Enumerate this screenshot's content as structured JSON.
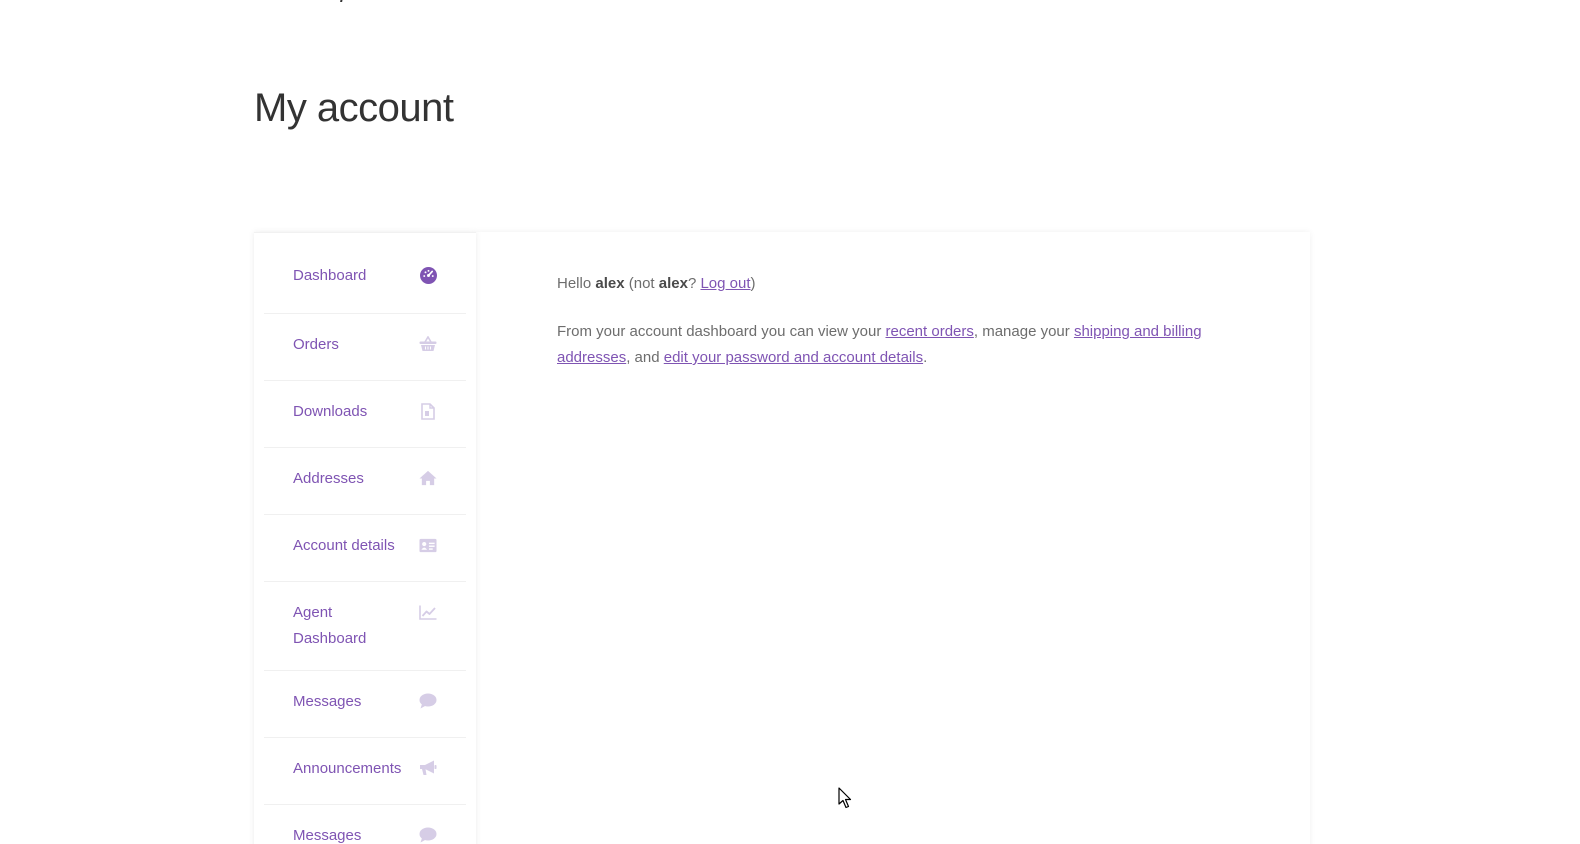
{
  "page": {
    "title": "My account"
  },
  "nav": {
    "items": [
      {
        "label": "Dashboard",
        "icon": "dashboard-icon",
        "active": true
      },
      {
        "label": "Orders",
        "icon": "basket-icon"
      },
      {
        "label": "Downloads",
        "icon": "file-icon"
      },
      {
        "label": "Addresses",
        "icon": "home-icon"
      },
      {
        "label": "Account details",
        "icon": "id-card-icon"
      },
      {
        "label": "Agent Dashboard",
        "icon": "chart-line-icon"
      },
      {
        "label": "Messages",
        "icon": "chat-icon"
      },
      {
        "label": "Announcements",
        "icon": "megaphone-icon"
      },
      {
        "label": "Messages",
        "icon": "chat-icon"
      }
    ]
  },
  "content": {
    "greeting": {
      "hello": "Hello ",
      "username": "alex",
      "not_prefix": " (not ",
      "not_username": "alex",
      "question": "? ",
      "logout_label": "Log out",
      "close_paren": ")"
    },
    "intro": {
      "text1": "From your account dashboard you can view your ",
      "link_orders": "recent orders",
      "text2": ", manage your ",
      "link_addresses": "shipping and billing addresses",
      "text3": ", and ",
      "link_account": "edit your password and account details",
      "text4": "."
    }
  },
  "colors": {
    "accent": "#7f54b3",
    "icon_muted": "#d6cde6",
    "icon_active": "#7f54b3",
    "text": "#6d6d6d",
    "title": "#333333"
  }
}
